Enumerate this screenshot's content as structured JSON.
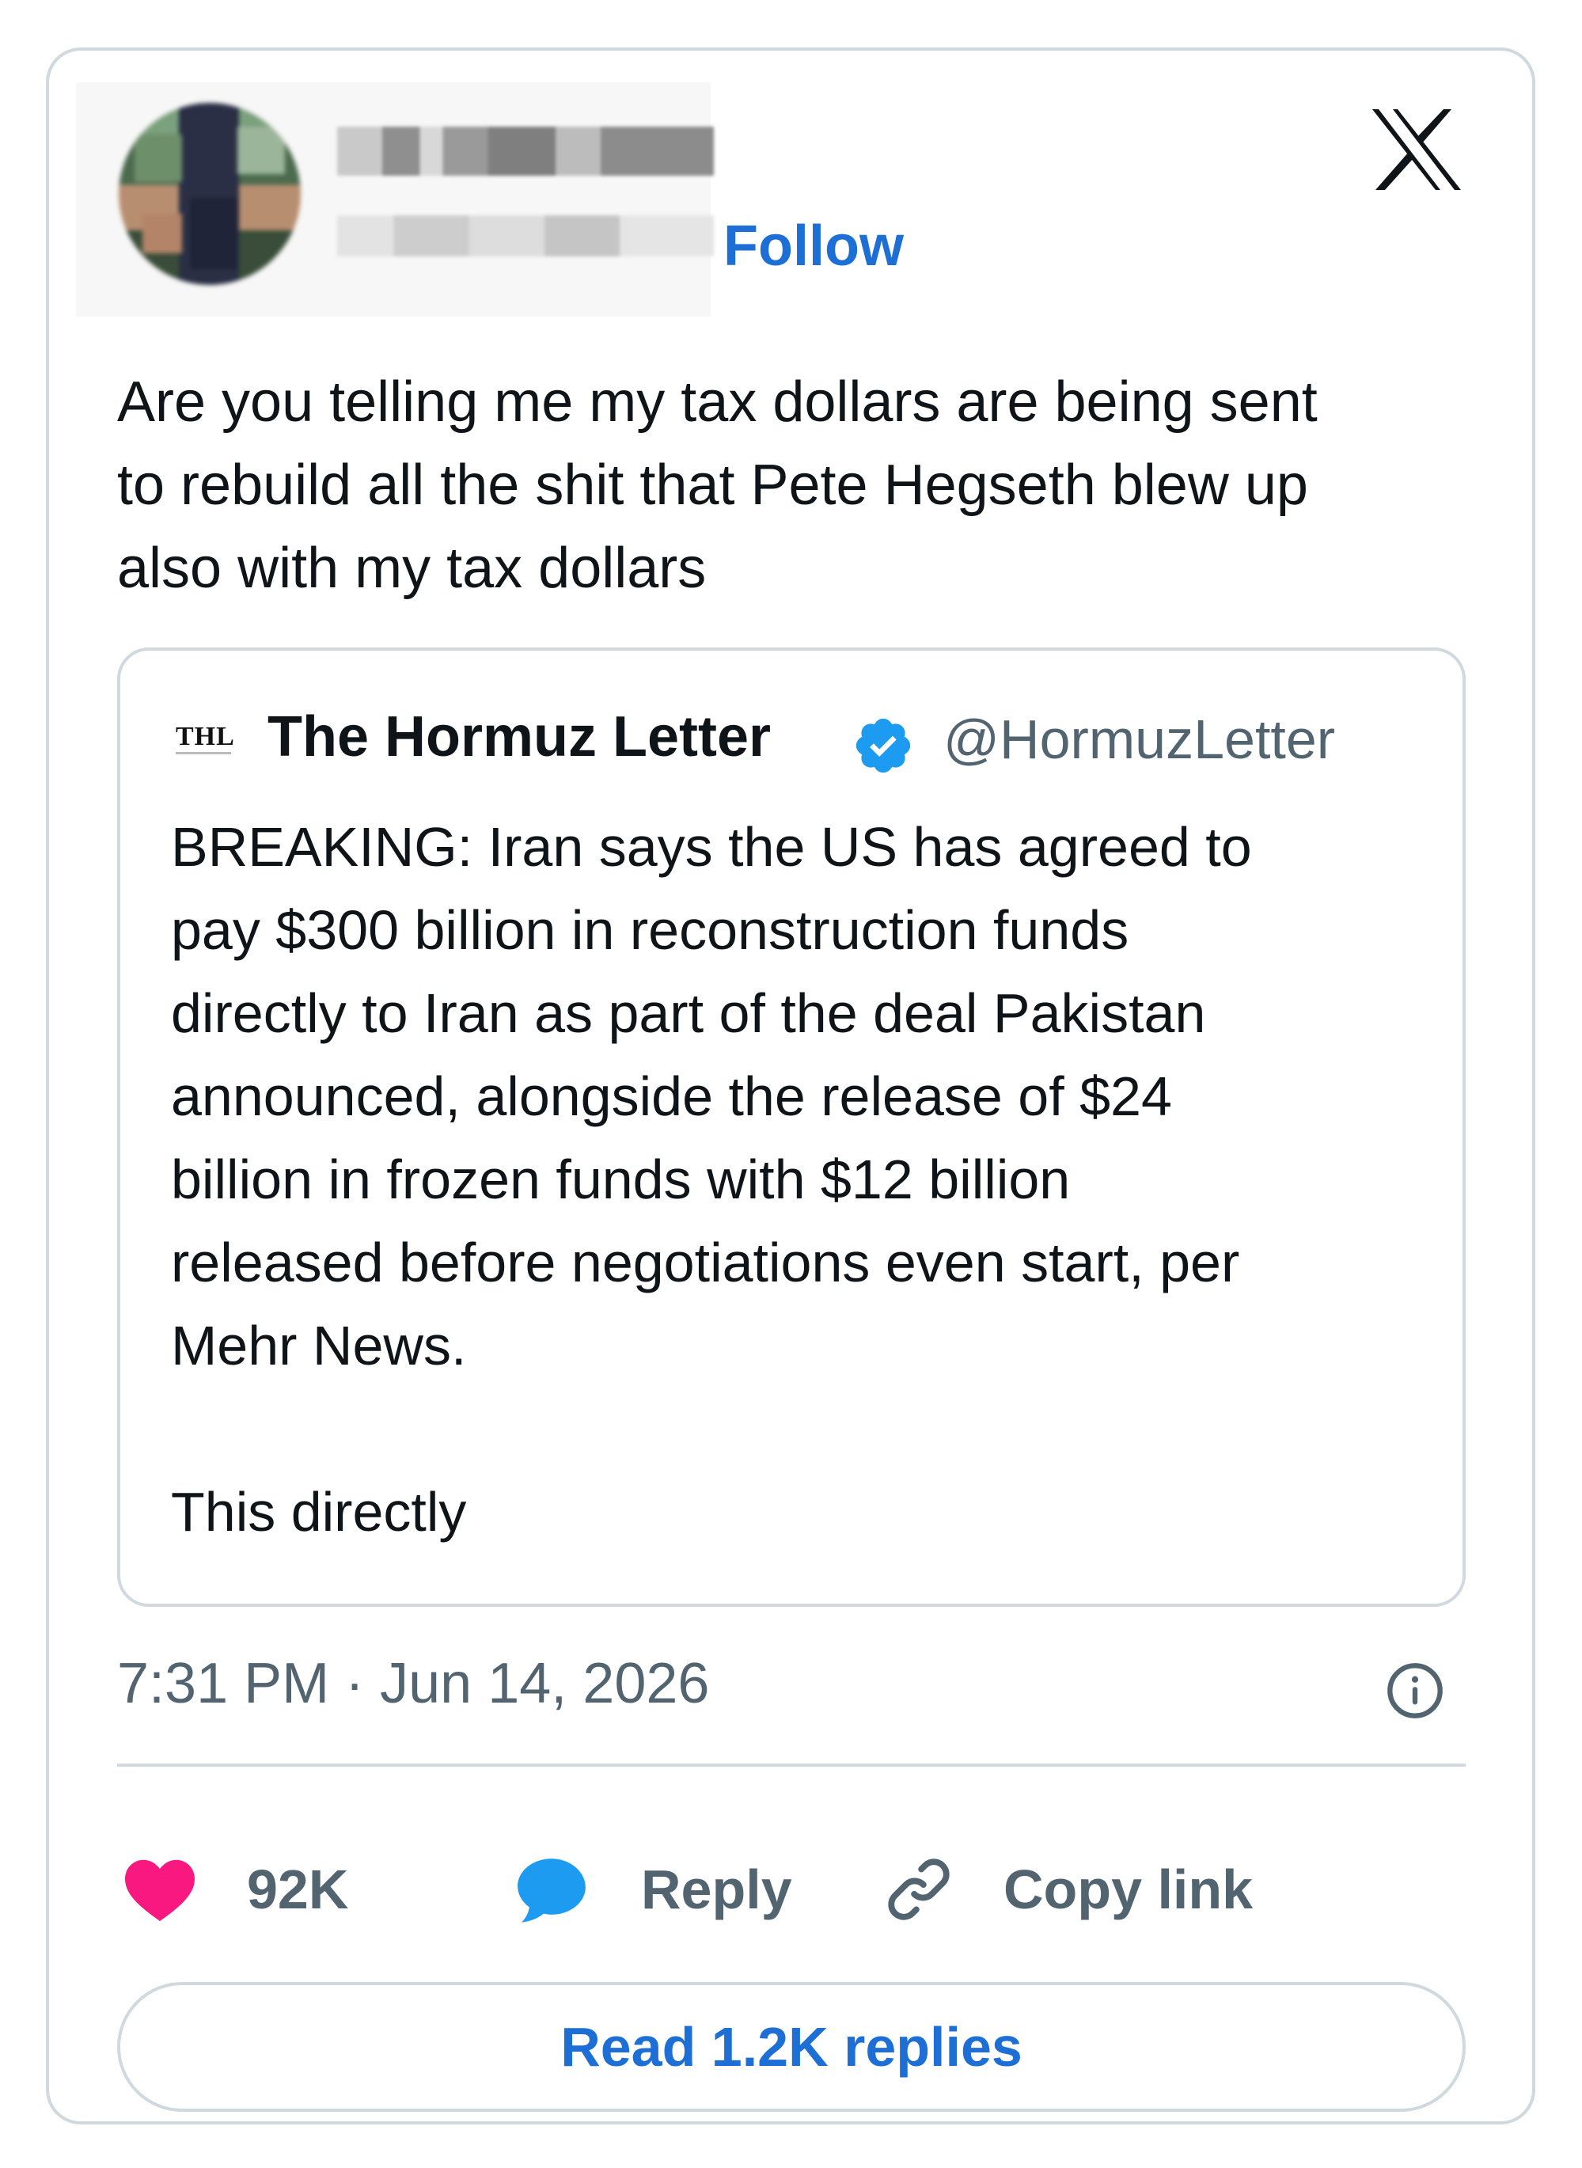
{
  "header": {
    "follow_label": "Follow",
    "logo_icon": "x-logo-icon"
  },
  "tweet": {
    "text": "Are you telling me my tax dollars are being sent\nto rebuild all the shit that Pete Hegseth blew up\nalso with my tax dollars"
  },
  "quote": {
    "logo_text": "THL",
    "name": "The Hormuz Letter",
    "verified_icon": "verified-badge-icon",
    "handle": "@HormuzLetter",
    "text": "BREAKING: Iran says the US has agreed to\npay $300 billion in reconstruction funds\ndirectly to Iran as part of the deal Pakistan\nannounced, alongside the release of $24\nbillion in frozen funds with $12 billion\nreleased before negotiations even start, per\nMehr News.\n\nThis directly"
  },
  "meta": {
    "timestamp": "7:31 PM · Jun 14, 2026",
    "info_icon": "info-icon"
  },
  "actions": {
    "like_count": "92K",
    "reply_label": "Reply",
    "copy_label": "Copy link"
  },
  "read_replies_label": "Read 1.2K replies",
  "colors": {
    "accent": "#1d6fd6",
    "like": "#f91880",
    "reply_icon": "#1d9bf0",
    "muted": "#536471",
    "border": "#cfd9de"
  }
}
